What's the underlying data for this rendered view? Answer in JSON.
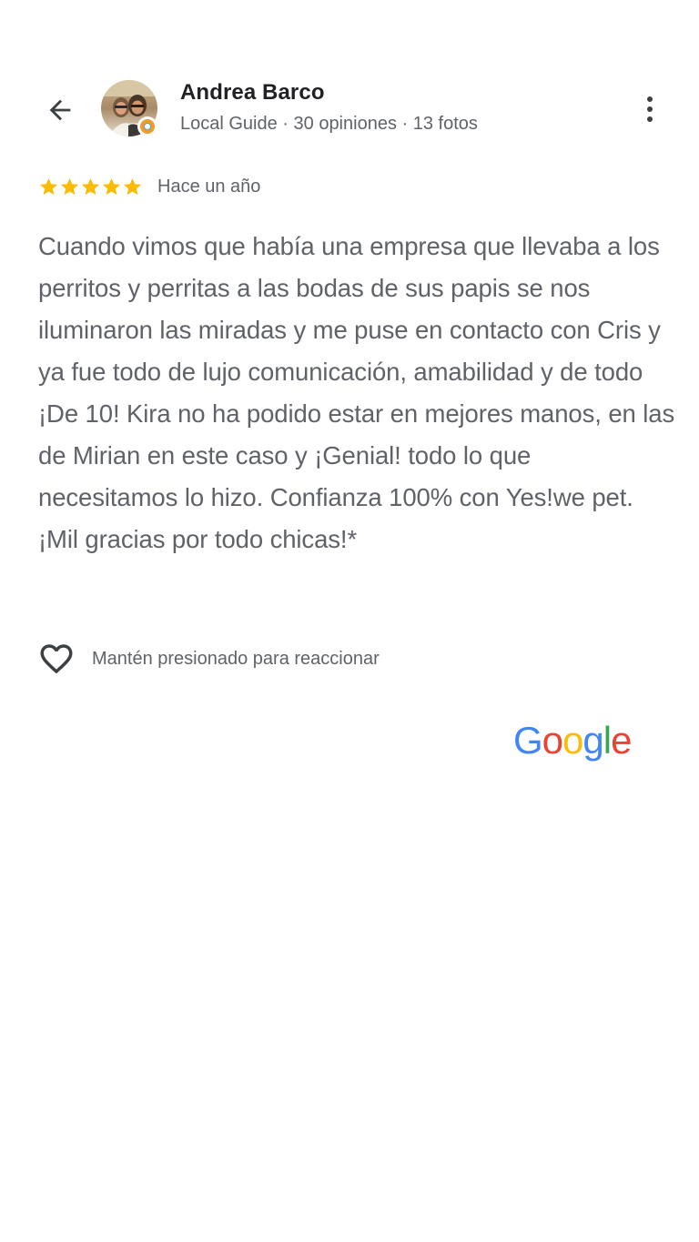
{
  "header": {
    "back_icon": "arrow-back-icon",
    "author_name": "Andrea Barco",
    "author_meta": "Local Guide · 30 opiniones · 13 fotos",
    "more_icon": "more-vert-icon"
  },
  "review": {
    "rating": 5,
    "rating_max": 5,
    "star_color": "#f9bb05",
    "time_ago": "Hace un año",
    "text": "Cuando vimos que había una empresa que llevaba a los perritos y perritas a las bodas de sus papis se nos iluminaron las miradas y me puse en contacto con Cris y ya fue todo de lujo comunicación, amabilidad y de todo ¡De 10! Kira no ha podido estar en mejores manos, en las de Mirian en este caso y ¡Genial! todo lo que necesitamos lo hizo. Confianza 100% con Yes!we pet. ¡Mil gracias por todo chicas!*"
  },
  "reaction": {
    "icon": "heart-outline-icon",
    "hint": "Mantén presionado para reaccionar"
  },
  "footer": {
    "logo_text": "Google",
    "logo_colors": [
      "#4285F4",
      "#EA4335",
      "#FBBC05",
      "#4285F4",
      "#34A853",
      "#EA4335"
    ]
  }
}
